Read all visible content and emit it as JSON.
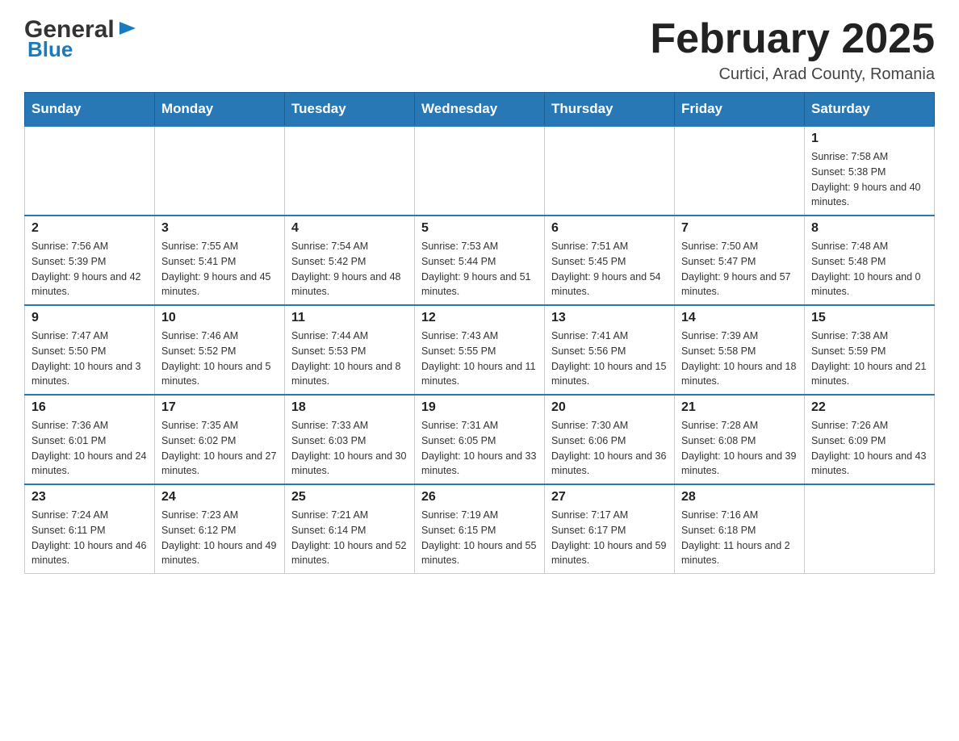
{
  "header": {
    "title": "February 2025",
    "subtitle": "Curtici, Arad County, Romania",
    "logo_general": "General",
    "logo_blue": "Blue"
  },
  "days_of_week": [
    "Sunday",
    "Monday",
    "Tuesday",
    "Wednesday",
    "Thursday",
    "Friday",
    "Saturday"
  ],
  "weeks": [
    [
      {
        "day": "",
        "info": ""
      },
      {
        "day": "",
        "info": ""
      },
      {
        "day": "",
        "info": ""
      },
      {
        "day": "",
        "info": ""
      },
      {
        "day": "",
        "info": ""
      },
      {
        "day": "",
        "info": ""
      },
      {
        "day": "1",
        "info": "Sunrise: 7:58 AM\nSunset: 5:38 PM\nDaylight: 9 hours and 40 minutes."
      }
    ],
    [
      {
        "day": "2",
        "info": "Sunrise: 7:56 AM\nSunset: 5:39 PM\nDaylight: 9 hours and 42 minutes."
      },
      {
        "day": "3",
        "info": "Sunrise: 7:55 AM\nSunset: 5:41 PM\nDaylight: 9 hours and 45 minutes."
      },
      {
        "day": "4",
        "info": "Sunrise: 7:54 AM\nSunset: 5:42 PM\nDaylight: 9 hours and 48 minutes."
      },
      {
        "day": "5",
        "info": "Sunrise: 7:53 AM\nSunset: 5:44 PM\nDaylight: 9 hours and 51 minutes."
      },
      {
        "day": "6",
        "info": "Sunrise: 7:51 AM\nSunset: 5:45 PM\nDaylight: 9 hours and 54 minutes."
      },
      {
        "day": "7",
        "info": "Sunrise: 7:50 AM\nSunset: 5:47 PM\nDaylight: 9 hours and 57 minutes."
      },
      {
        "day": "8",
        "info": "Sunrise: 7:48 AM\nSunset: 5:48 PM\nDaylight: 10 hours and 0 minutes."
      }
    ],
    [
      {
        "day": "9",
        "info": "Sunrise: 7:47 AM\nSunset: 5:50 PM\nDaylight: 10 hours and 3 minutes."
      },
      {
        "day": "10",
        "info": "Sunrise: 7:46 AM\nSunset: 5:52 PM\nDaylight: 10 hours and 5 minutes."
      },
      {
        "day": "11",
        "info": "Sunrise: 7:44 AM\nSunset: 5:53 PM\nDaylight: 10 hours and 8 minutes."
      },
      {
        "day": "12",
        "info": "Sunrise: 7:43 AM\nSunset: 5:55 PM\nDaylight: 10 hours and 11 minutes."
      },
      {
        "day": "13",
        "info": "Sunrise: 7:41 AM\nSunset: 5:56 PM\nDaylight: 10 hours and 15 minutes."
      },
      {
        "day": "14",
        "info": "Sunrise: 7:39 AM\nSunset: 5:58 PM\nDaylight: 10 hours and 18 minutes."
      },
      {
        "day": "15",
        "info": "Sunrise: 7:38 AM\nSunset: 5:59 PM\nDaylight: 10 hours and 21 minutes."
      }
    ],
    [
      {
        "day": "16",
        "info": "Sunrise: 7:36 AM\nSunset: 6:01 PM\nDaylight: 10 hours and 24 minutes."
      },
      {
        "day": "17",
        "info": "Sunrise: 7:35 AM\nSunset: 6:02 PM\nDaylight: 10 hours and 27 minutes."
      },
      {
        "day": "18",
        "info": "Sunrise: 7:33 AM\nSunset: 6:03 PM\nDaylight: 10 hours and 30 minutes."
      },
      {
        "day": "19",
        "info": "Sunrise: 7:31 AM\nSunset: 6:05 PM\nDaylight: 10 hours and 33 minutes."
      },
      {
        "day": "20",
        "info": "Sunrise: 7:30 AM\nSunset: 6:06 PM\nDaylight: 10 hours and 36 minutes."
      },
      {
        "day": "21",
        "info": "Sunrise: 7:28 AM\nSunset: 6:08 PM\nDaylight: 10 hours and 39 minutes."
      },
      {
        "day": "22",
        "info": "Sunrise: 7:26 AM\nSunset: 6:09 PM\nDaylight: 10 hours and 43 minutes."
      }
    ],
    [
      {
        "day": "23",
        "info": "Sunrise: 7:24 AM\nSunset: 6:11 PM\nDaylight: 10 hours and 46 minutes."
      },
      {
        "day": "24",
        "info": "Sunrise: 7:23 AM\nSunset: 6:12 PM\nDaylight: 10 hours and 49 minutes."
      },
      {
        "day": "25",
        "info": "Sunrise: 7:21 AM\nSunset: 6:14 PM\nDaylight: 10 hours and 52 minutes."
      },
      {
        "day": "26",
        "info": "Sunrise: 7:19 AM\nSunset: 6:15 PM\nDaylight: 10 hours and 55 minutes."
      },
      {
        "day": "27",
        "info": "Sunrise: 7:17 AM\nSunset: 6:17 PM\nDaylight: 10 hours and 59 minutes."
      },
      {
        "day": "28",
        "info": "Sunrise: 7:16 AM\nSunset: 6:18 PM\nDaylight: 11 hours and 2 minutes."
      },
      {
        "day": "",
        "info": ""
      }
    ]
  ]
}
